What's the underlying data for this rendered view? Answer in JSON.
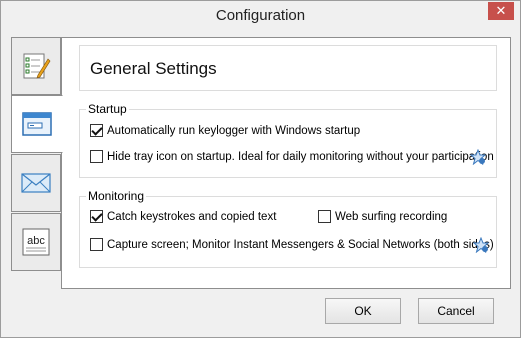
{
  "window": {
    "title": "Configuration",
    "close_label": "✕"
  },
  "tabs": [
    {
      "icon": "checklist-pencil-icon"
    },
    {
      "icon": "window-icon"
    },
    {
      "icon": "envelope-icon"
    },
    {
      "icon": "abc-text-icon"
    }
  ],
  "header": {
    "title": "General Settings"
  },
  "startup": {
    "label": "Startup",
    "options": [
      {
        "label": "Automatically run keylogger with Windows startup",
        "checked": true
      },
      {
        "label": "Hide tray icon on startup. Ideal for daily monitoring without your participation",
        "checked": false
      }
    ]
  },
  "monitoring": {
    "label": "Monitoring",
    "options": [
      {
        "label": "Catch keystrokes and copied text",
        "checked": true
      },
      {
        "label": "Web surfing recording",
        "checked": false
      },
      {
        "label": "Capture screen; Monitor Instant Messengers & Social Networks (both sides)",
        "checked": false
      }
    ]
  },
  "buttons": {
    "ok": "OK",
    "cancel": "Cancel"
  }
}
